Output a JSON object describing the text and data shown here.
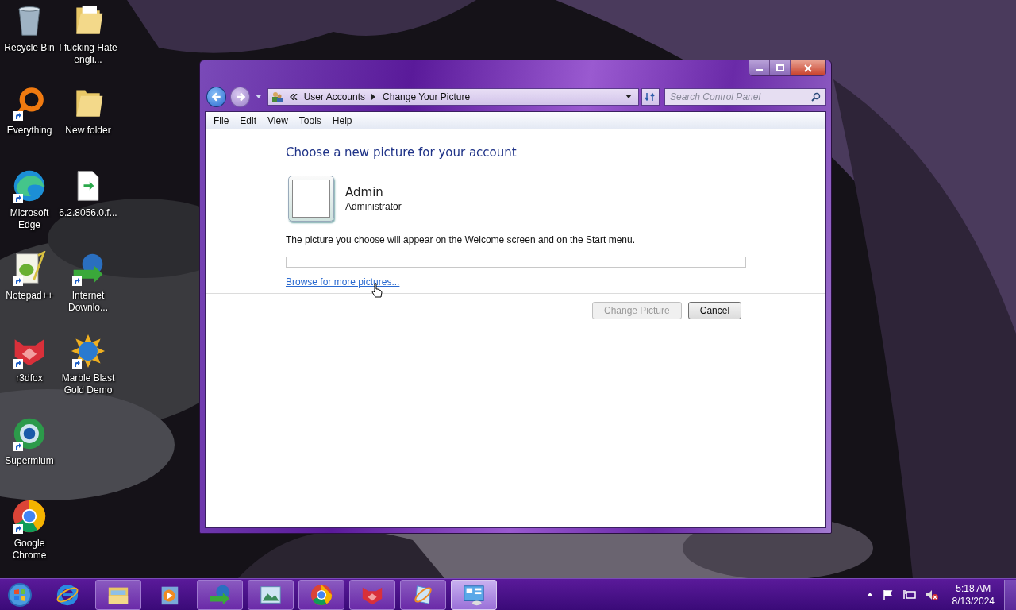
{
  "desktop_icons": [
    {
      "label": "Recycle Bin",
      "shortcut": false
    },
    {
      "label": "Everything",
      "shortcut": true
    },
    {
      "label": "Microsoft Edge",
      "shortcut": true
    },
    {
      "label": "Notepad++",
      "shortcut": true
    },
    {
      "label": "r3dfox",
      "shortcut": true
    },
    {
      "label": "Supermium",
      "shortcut": true
    },
    {
      "label": "Google Chrome",
      "shortcut": true
    },
    {
      "label": "I fucking Hate engli...",
      "shortcut": false
    },
    {
      "label": "New folder",
      "shortcut": false
    },
    {
      "label": "6.2.8056.0.f...",
      "shortcut": false
    },
    {
      "label": "Internet Downlo...",
      "shortcut": true
    },
    {
      "label": "Marble Blast Gold Demo",
      "shortcut": true
    }
  ],
  "window": {
    "navigation": {
      "back": {
        "disabled": false
      },
      "forward": {
        "disabled": true
      }
    },
    "breadcrumbs": [
      "User Accounts",
      "Change Your Picture"
    ],
    "search": {
      "placeholder": "Search Control Panel"
    },
    "menu": [
      "File",
      "Edit",
      "View",
      "Tools",
      "Help"
    ],
    "content": {
      "heading": "Choose a new picture for your account",
      "account": {
        "name": "Admin",
        "type": "Administrator"
      },
      "description": "The picture you choose will appear on the Welcome screen and on the Start menu.",
      "browse_link": "Browse for more pictures...",
      "buttons": [
        {
          "label": "Change Picture",
          "disabled": true
        },
        {
          "label": "Cancel",
          "disabled": false
        }
      ]
    }
  },
  "taskbar": {
    "items": [
      {
        "running": false,
        "active": false
      },
      {
        "running": true,
        "active": false
      },
      {
        "running": false,
        "active": false
      },
      {
        "running": true,
        "active": false
      },
      {
        "running": true,
        "active": false
      },
      {
        "running": true,
        "active": false
      },
      {
        "running": true,
        "active": false
      },
      {
        "running": true,
        "active": false
      },
      {
        "running": true,
        "active": true
      }
    ],
    "clock": {
      "time": "5:18 AM",
      "date": "8/13/2024"
    }
  }
}
